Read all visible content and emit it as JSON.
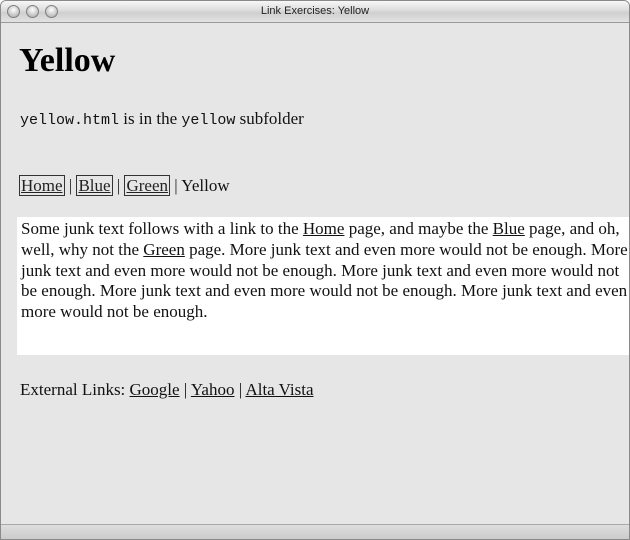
{
  "window": {
    "title": "Link Exercises: Yellow"
  },
  "page": {
    "heading": "Yellow",
    "subfolder": {
      "file": "yellow.html",
      "middle": " is in the ",
      "folder": "yellow",
      "end": " subfolder"
    },
    "nav": {
      "home": "Home",
      "blue": "Blue",
      "green": "Green",
      "current": "Yellow",
      "separator": "|"
    },
    "junk": {
      "t1": "Some junk text follows with a link to the ",
      "home_link": "Home",
      "t2": " page, and maybe the ",
      "blue_link": "Blue",
      "t3": " page, and oh, well, why not the ",
      "green_link": "Green",
      "t4": " page. More junk text and even more would not be enough. More junk text and even more would not be enough. More junk text and even more would not be enough. More junk text and even more would not be enough. More junk text and even more would not be enough."
    },
    "external": {
      "label": "External Links: ",
      "google": "Google",
      "yahoo": "Yahoo",
      "altavista": "Alta Vista",
      "separator": "|"
    }
  }
}
